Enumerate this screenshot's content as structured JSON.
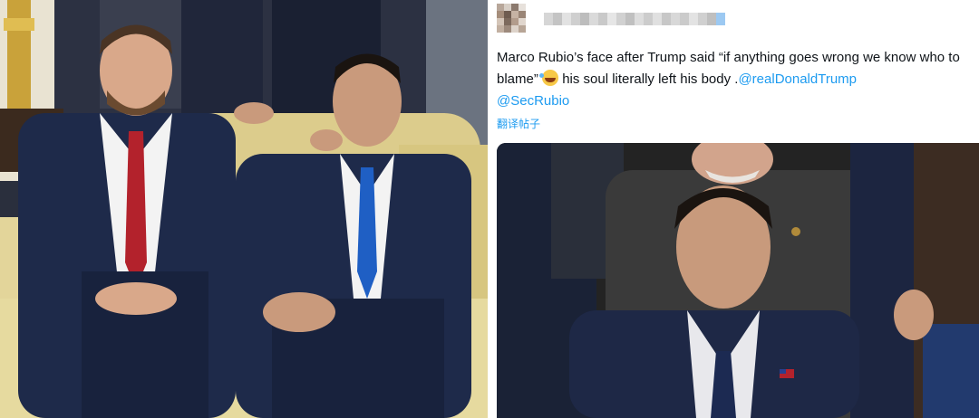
{
  "tweet": {
    "text_before": "Marco Rubio’s face after Trump said “if anything goes wrong we know who to blame” ",
    "emoji_name": "rolling-on-floor-laughing-emoji",
    "text_after": " his soul literally left his body .",
    "mention_1": "@realDonaldTrump",
    "mention_2": "@SecRubio",
    "translate_label": "翻译帖子"
  },
  "colors": {
    "mention": "#1d9bf0",
    "text": "#0f1419",
    "suit_navy": "#1e2a4a",
    "tie_red": "#b3222c",
    "tie_blue": "#1f5fc4",
    "sofa_gold": "#e3d59a"
  }
}
